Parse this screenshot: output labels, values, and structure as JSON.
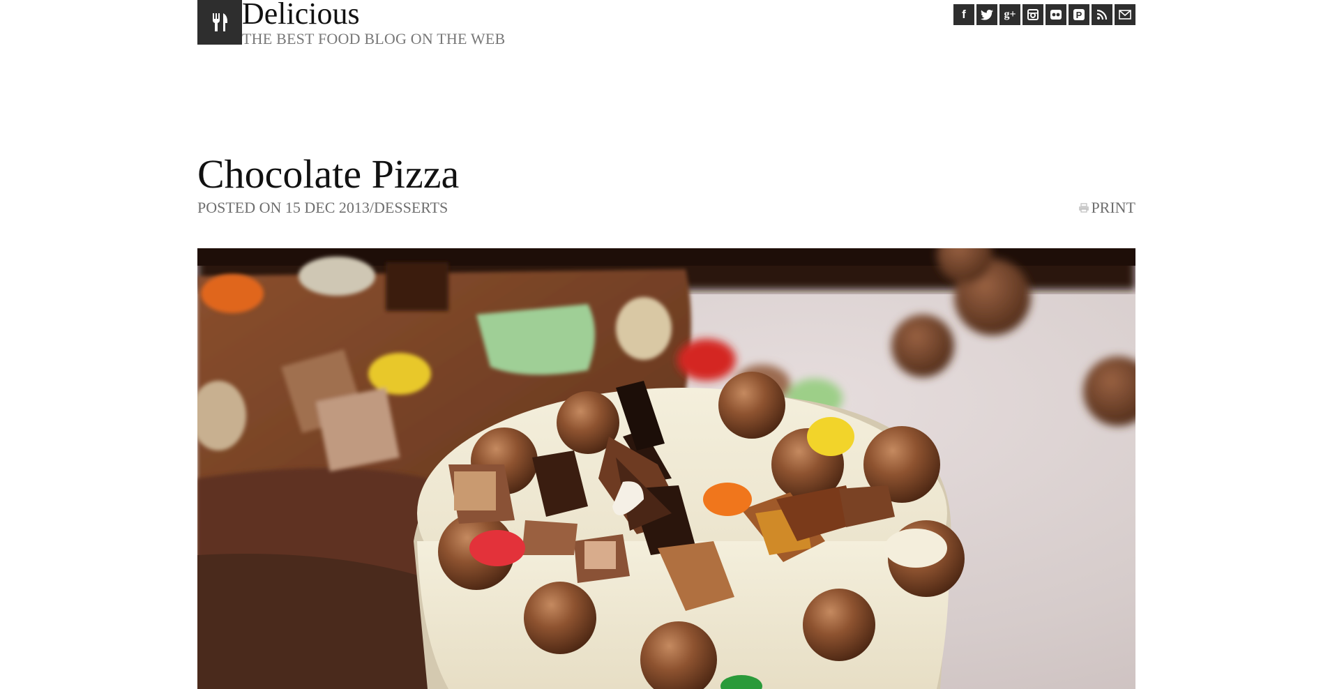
{
  "site": {
    "title": "Delicious",
    "tagline": "THE BEST FOOD BLOG ON THE WEB",
    "logo_icon": "fork-knife-icon",
    "social": [
      {
        "name": "facebook-icon",
        "glyph": "f"
      },
      {
        "name": "twitter-icon",
        "glyph": ""
      },
      {
        "name": "google-plus-icon",
        "glyph": "g+"
      },
      {
        "name": "instagram-icon",
        "glyph": ""
      },
      {
        "name": "flickr-icon",
        "glyph": ""
      },
      {
        "name": "pinterest-icon",
        "glyph": "P"
      },
      {
        "name": "rss-icon",
        "glyph": ""
      },
      {
        "name": "email-icon",
        "glyph": ""
      }
    ]
  },
  "post": {
    "title": "Chocolate Pizza",
    "meta_prefix": "POSTED ON 15 DEC 2013/",
    "category": "DESSERTS",
    "print_label": "PRINT",
    "print_icon": "printer-icon"
  },
  "colors": {
    "dark": "#2e2e2e",
    "meta_gray": "#6e6e6e"
  }
}
